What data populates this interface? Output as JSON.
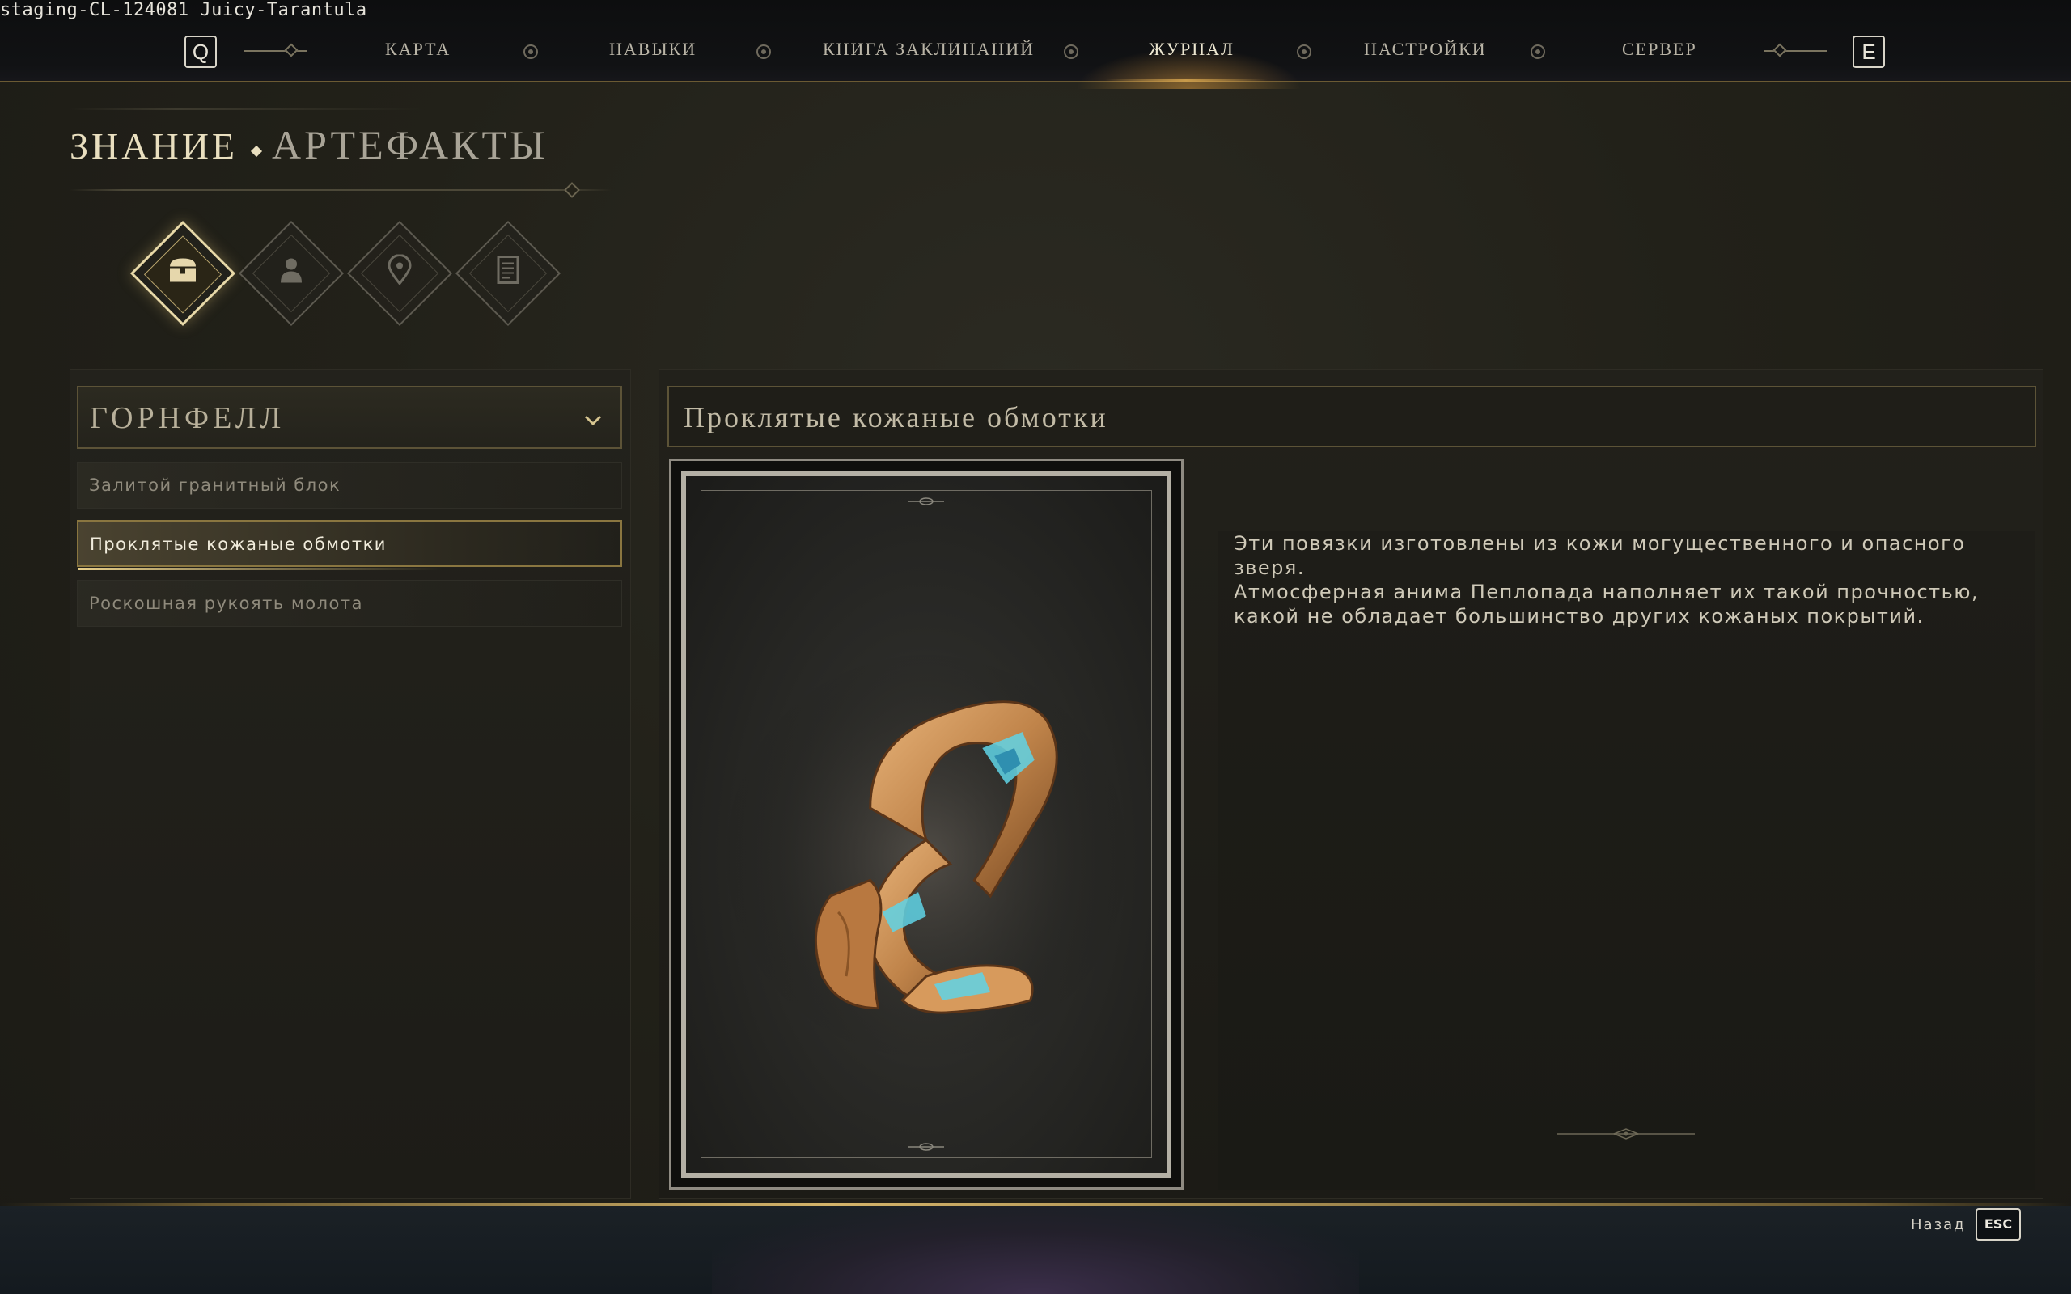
{
  "build_label": "staging-CL-124081 Juicy-Tarantula",
  "nav": {
    "left_key": "Q",
    "right_key": "E",
    "items": [
      "КАРТА",
      "НАВЫКИ",
      "КНИГА ЗАКЛИНАНИЙ",
      "ЖУРНАЛ",
      "НАСТРОЙКИ",
      "СЕРВЕР"
    ],
    "active": "ЖУРНАЛ"
  },
  "heading": {
    "section": "ЗНАНИЕ",
    "subsection": "АРТЕФАКТЫ"
  },
  "categories": [
    {
      "icon": "chest-icon",
      "active": true
    },
    {
      "icon": "character-icon",
      "active": false
    },
    {
      "icon": "location-pin-icon",
      "active": false
    },
    {
      "icon": "scroll-icon",
      "active": false
    }
  ],
  "region": {
    "label": "ГОРНФЕЛЛ"
  },
  "lore_items": [
    {
      "label": "Залитой гранитный блок",
      "selected": false
    },
    {
      "label": "Проклятые кожаные обмотки",
      "selected": true
    },
    {
      "label": "Роскошная рукоять молота",
      "selected": false
    }
  ],
  "detail": {
    "title": "Проклятые кожаные обмотки",
    "description_lines": [
      "Эти повязки изготовлены из кожи могущественного и опасного зверя.",
      "Атмосферная анима Пеплопада наполняет их такой прочностью,",
      "какой не обладает большинство других кожаных покрытий."
    ]
  },
  "footer": {
    "back_label": "Назад",
    "back_key": "ESC"
  },
  "colors": {
    "accent_gold": "#d4b46a",
    "artifact_leather": "#c0844a",
    "artifact_rune": "#5fd3e6"
  }
}
